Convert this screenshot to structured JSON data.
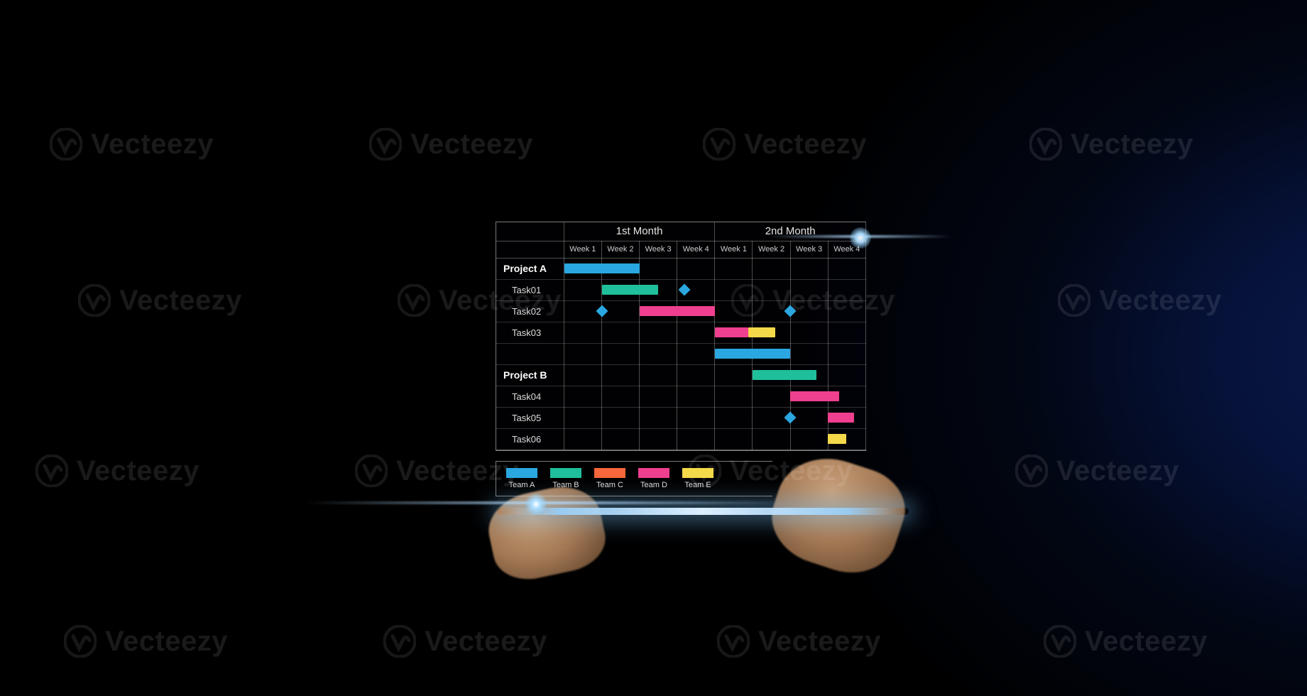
{
  "watermark": "Vecteezy",
  "chart_data": {
    "type": "gantt",
    "months": [
      "1st  Month",
      "2nd  Month"
    ],
    "weeks": [
      "Week 1",
      "Week 2",
      "Week 3",
      "Week 4",
      "Week 1",
      "Week 2",
      "Week 3",
      "Week 4"
    ],
    "teams": [
      {
        "name": "Team A",
        "color": "#2aa7e0"
      },
      {
        "name": "Team B",
        "color": "#1fbf9c"
      },
      {
        "name": "Team C",
        "color": "#f6673b"
      },
      {
        "name": "Team D",
        "color": "#ef3f8f"
      },
      {
        "name": "Team E",
        "color": "#f4d94a"
      }
    ],
    "rows": [
      {
        "label": "Project A",
        "type": "project",
        "bars": [
          {
            "team": 0,
            "start": 1,
            "end": 3
          }
        ],
        "milestones": []
      },
      {
        "label": "Task01",
        "type": "task",
        "bars": [
          {
            "team": 1,
            "start": 2,
            "end": 3.5
          }
        ],
        "milestones": [
          {
            "team": 0,
            "at": 4.2
          }
        ]
      },
      {
        "label": "Task02",
        "type": "task",
        "bars": [
          {
            "team": 3,
            "start": 3,
            "end": 5
          }
        ],
        "milestones": [
          {
            "team": 0,
            "at": 2
          },
          {
            "team": 0,
            "at": 7
          }
        ]
      },
      {
        "label": "Task03",
        "type": "task",
        "bars": [
          {
            "team": 3,
            "start": 5,
            "end": 5.9
          },
          {
            "team": 4,
            "start": 5.9,
            "end": 6.6
          }
        ],
        "milestones": []
      },
      {
        "label": "",
        "type": "spacer",
        "bars": [
          {
            "team": 0,
            "start": 5,
            "end": 7
          }
        ],
        "milestones": []
      },
      {
        "label": "Project B",
        "type": "project",
        "bars": [
          {
            "team": 1,
            "start": 6,
            "end": 7.7
          }
        ],
        "milestones": []
      },
      {
        "label": "Task04",
        "type": "task",
        "bars": [
          {
            "team": 3,
            "start": 7,
            "end": 8.3
          }
        ],
        "milestones": []
      },
      {
        "label": "Task05",
        "type": "task",
        "bars": [
          {
            "team": 3,
            "start": 8,
            "end": 8.7
          }
        ],
        "milestones": [
          {
            "team": 0,
            "at": 7
          }
        ]
      },
      {
        "label": "Task06",
        "type": "task",
        "bars": [
          {
            "team": 4,
            "start": 8,
            "end": 8.5
          }
        ],
        "milestones": []
      }
    ]
  }
}
